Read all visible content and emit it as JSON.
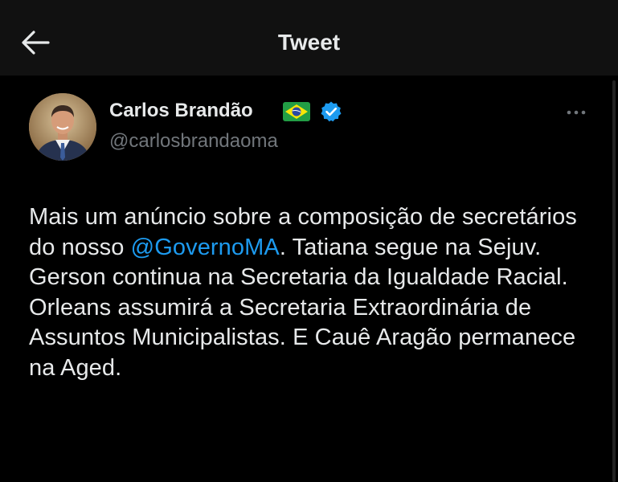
{
  "header": {
    "title": "Tweet",
    "back_icon": "arrow-left-icon"
  },
  "author": {
    "display_name": "Carlos Brandão",
    "handle": "@carlosbrandaoma",
    "flag_icon": "brazil-flag-icon",
    "verified_icon": "verified-badge-icon"
  },
  "tweet": {
    "text_before_mention": "Mais um anúncio sobre a composição de secretários do nosso ",
    "mention": "@GovernoMA",
    "text_after_mention": ". Tatiana segue na Sejuv. Gerson continua na Secretaria da Igualdade Racial. Orleans assumirá a Secretaria Extraordinária de Assuntos Municipalistas. E Cauê Aragão permanece na Aged."
  },
  "colors": {
    "background": "#000000",
    "header_background": "#111111",
    "text": "#e7e9ea",
    "secondary_text": "#71767b",
    "accent": "#1d9bf0"
  }
}
